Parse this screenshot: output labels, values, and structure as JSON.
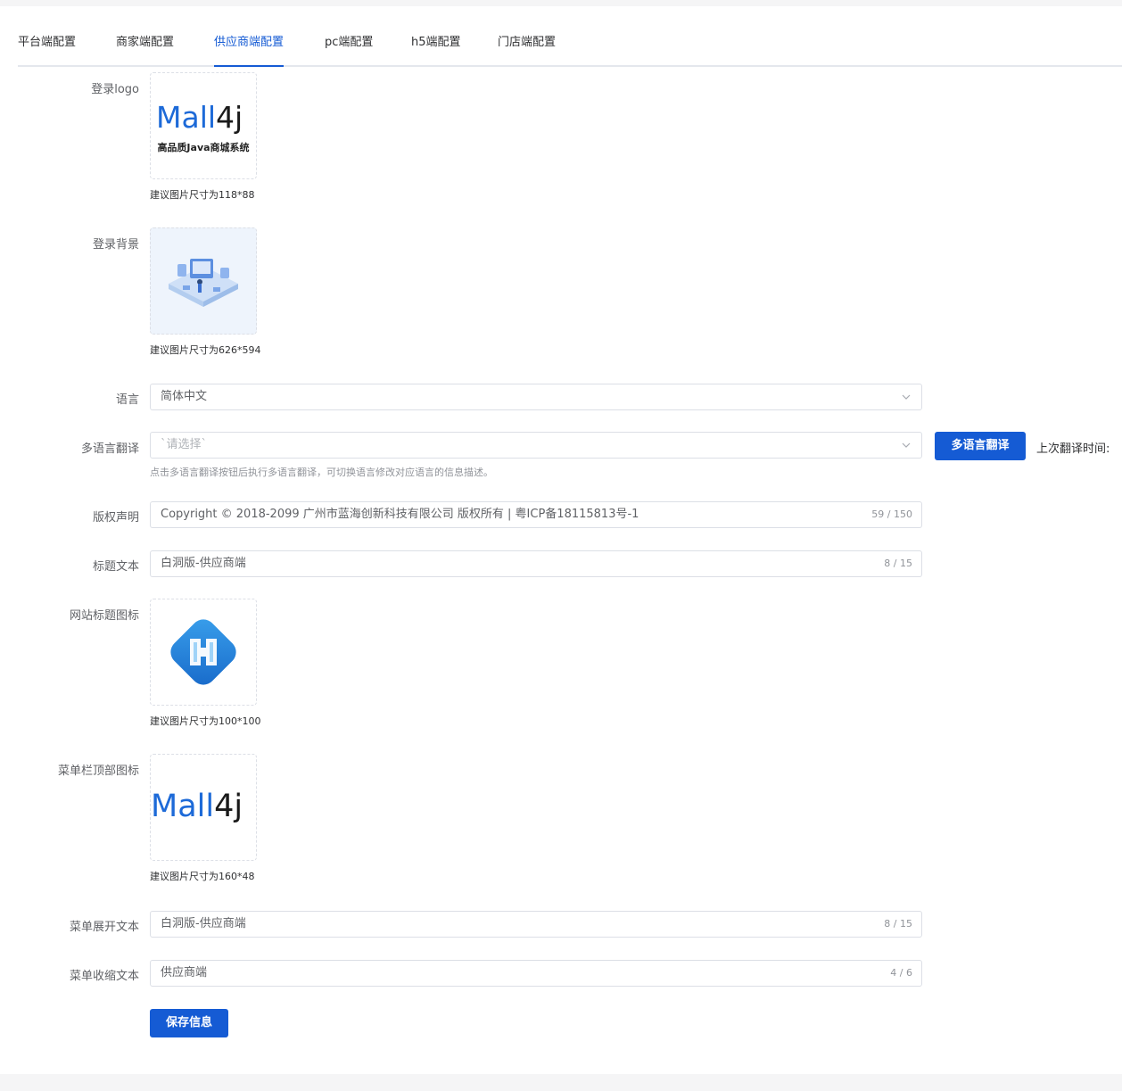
{
  "tabs": [
    {
      "label": "平台端配置"
    },
    {
      "label": "商家端配置"
    },
    {
      "label": "供应商端配置"
    },
    {
      "label": "pc端配置"
    },
    {
      "label": "h5端配置"
    },
    {
      "label": "门店端配置"
    }
  ],
  "active_tab": "供应商端配置",
  "login_logo": {
    "label": "登录logo",
    "logo_text_blue": "Mall",
    "logo_text_dark": "4j",
    "logo_subtitle": "高品质Java商城系统",
    "hint": "建议图片尺寸为118*88"
  },
  "login_bg": {
    "label": "登录背景",
    "hint": "建议图片尺寸为626*594"
  },
  "language": {
    "label": "语言",
    "value": "简体中文"
  },
  "translation": {
    "label": "多语言翻译",
    "placeholder": "`请选择`",
    "button": "多语言翻译",
    "last_time_label": "上次翻译时间:",
    "hint": "点击多语言翻译按钮后执行多语言翻译，可切换语言修改对应语言的信息描述。"
  },
  "copyright": {
    "label": "版权声明",
    "value": "Copyright © 2018-2099 广州市蓝海创新科技有限公司 版权所有 | 粤ICP备18115813号-1",
    "count": "59 / 150"
  },
  "title_text": {
    "label": "标题文本",
    "value": "白洞版-供应商端",
    "count": "8 / 15"
  },
  "favicon": {
    "label": "网站标题图标",
    "hint": "建议图片尺寸为100*100"
  },
  "menu_icon": {
    "label": "菜单栏顶部图标",
    "logo_text_blue": "Mall",
    "logo_text_dark": "4j",
    "hint": "建议图片尺寸为160*48"
  },
  "menu_expand": {
    "label": "菜单展开文本",
    "value": "白洞版-供应商端",
    "count": "8 / 15"
  },
  "menu_collapse": {
    "label": "菜单收缩文本",
    "value": "供应商端",
    "count": "4 / 6"
  },
  "save_button": "保存信息",
  "colors": {
    "primary": "#155bd4",
    "brand_blue": "#1d6ad8"
  }
}
